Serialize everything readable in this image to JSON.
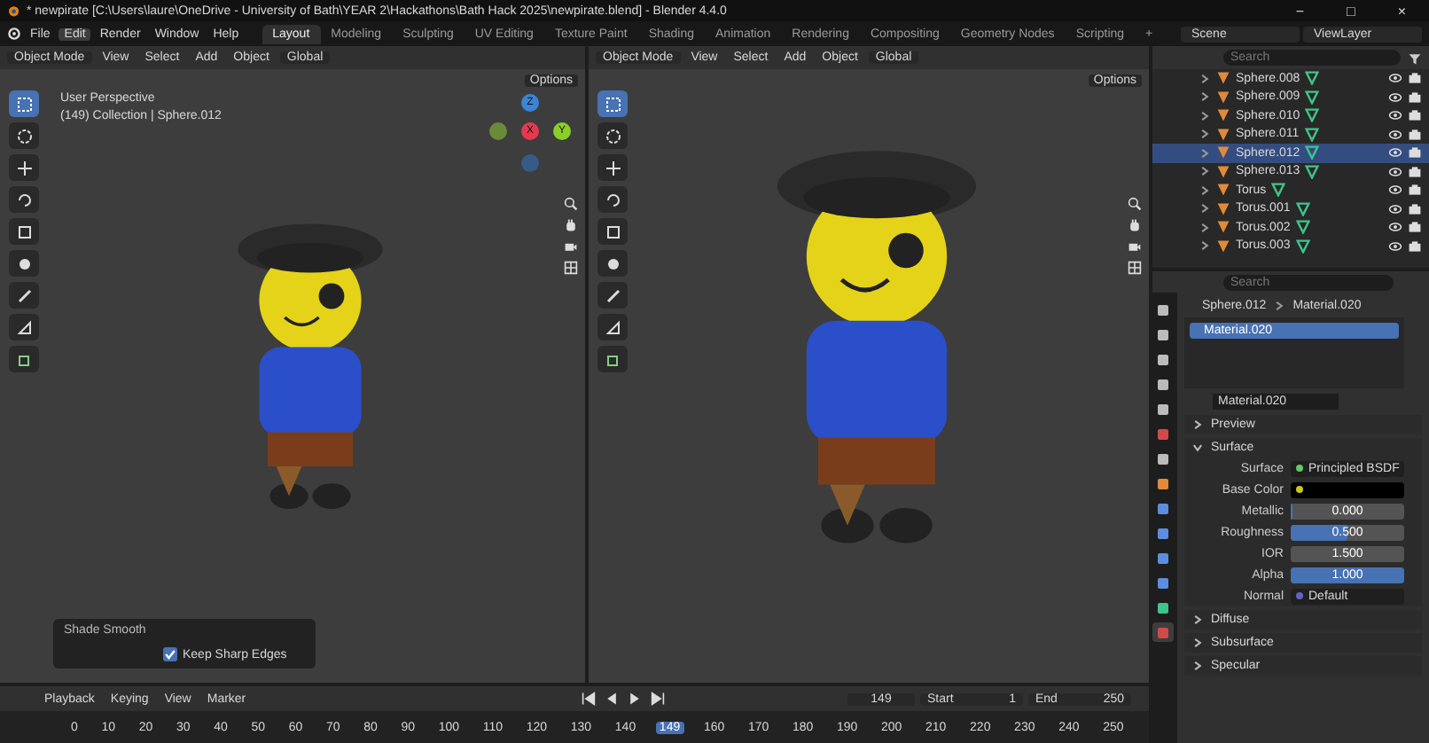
{
  "window": {
    "title": "* newpirate [C:\\Users\\laure\\OneDrive - University of Bath\\YEAR 2\\Hackathons\\Bath Hack 2025\\newpirate.blend] - Blender 4.4.0",
    "controls": [
      "−",
      "□",
      "×"
    ]
  },
  "menus": [
    {
      "label": "File",
      "selected": false
    },
    {
      "label": "Edit",
      "selected": true
    },
    {
      "label": "Render",
      "selected": false
    },
    {
      "label": "Window",
      "selected": false
    },
    {
      "label": "Help",
      "selected": false
    }
  ],
  "workspaces": [
    {
      "label": "Layout",
      "selected": true
    },
    {
      "label": "Modeling",
      "selected": false
    },
    {
      "label": "Sculpting",
      "selected": false
    },
    {
      "label": "UV Editing",
      "selected": false
    },
    {
      "label": "Texture Paint",
      "selected": false
    },
    {
      "label": "Shading",
      "selected": false
    },
    {
      "label": "Animation",
      "selected": false
    },
    {
      "label": "Rendering",
      "selected": false
    },
    {
      "label": "Compositing",
      "selected": false
    },
    {
      "label": "Geometry Nodes",
      "selected": false
    },
    {
      "label": "Scripting",
      "selected": false
    }
  ],
  "add_workspace": "+",
  "scene": "Scene",
  "view_layer": "ViewLayer",
  "viewports": [
    {
      "mode": "Object Mode",
      "menus": [
        "View",
        "Select",
        "Add",
        "Object"
      ],
      "orientation": "Global",
      "options": "Options",
      "overlay_lines": [
        "User Perspective",
        "(149) Collection | Sphere.012"
      ],
      "axes": [
        "Z",
        "X",
        "Y"
      ],
      "tools": [
        {
          "kind": "select",
          "selected": true
        },
        {
          "kind": "cursor",
          "selected": false
        },
        {
          "kind": "move",
          "selected": false
        },
        {
          "kind": "rotate",
          "selected": false
        },
        {
          "kind": "scale",
          "selected": false
        },
        {
          "kind": "transform",
          "selected": false
        },
        {
          "kind": "annotate",
          "selected": false
        },
        {
          "kind": "measure",
          "selected": false
        },
        {
          "kind": "cube",
          "selected": false
        }
      ],
      "operator_panel": {
        "title": "Shade Smooth",
        "option": {
          "label": "Keep Sharp Edges",
          "checked": true
        }
      }
    },
    {
      "mode": "Object Mode",
      "menus": [
        "View",
        "Select",
        "Add",
        "Object"
      ],
      "orientation": "Global",
      "options": "Options",
      "tools": [
        {
          "kind": "select",
          "selected": true
        },
        {
          "kind": "cursor",
          "selected": false
        },
        {
          "kind": "move",
          "selected": false
        },
        {
          "kind": "rotate",
          "selected": false
        },
        {
          "kind": "scale",
          "selected": false
        },
        {
          "kind": "transform",
          "selected": false
        },
        {
          "kind": "annotate",
          "selected": false
        },
        {
          "kind": "measure",
          "selected": false
        },
        {
          "kind": "cube",
          "selected": false
        }
      ]
    }
  ],
  "outliner": {
    "search": {
      "placeholder": "Search"
    },
    "rows": [
      {
        "name": "Sphere.008",
        "selected": false
      },
      {
        "name": "Sphere.009",
        "selected": false
      },
      {
        "name": "Sphere.010",
        "selected": false
      },
      {
        "name": "Sphere.011",
        "selected": false
      },
      {
        "name": "Sphere.012",
        "selected": true
      },
      {
        "name": "Sphere.013",
        "selected": false
      },
      {
        "name": "Torus",
        "selected": false
      },
      {
        "name": "Torus.001",
        "selected": false
      },
      {
        "name": "Torus.002",
        "selected": false
      },
      {
        "name": "Torus.003",
        "selected": false
      }
    ]
  },
  "properties": {
    "search": {
      "placeholder": "Search"
    },
    "tabs": [
      {
        "kind": "tool",
        "selected": false
      },
      {
        "kind": "render",
        "selected": false
      },
      {
        "kind": "output",
        "selected": false
      },
      {
        "kind": "view-layer",
        "selected": false
      },
      {
        "kind": "scene",
        "selected": false
      },
      {
        "kind": "world",
        "selected": false
      },
      {
        "kind": "collection",
        "selected": false
      },
      {
        "kind": "object",
        "selected": false
      },
      {
        "kind": "modifier",
        "selected": false
      },
      {
        "kind": "particles",
        "selected": false
      },
      {
        "kind": "physics",
        "selected": false
      },
      {
        "kind": "constraint",
        "selected": false
      },
      {
        "kind": "data",
        "selected": false
      },
      {
        "kind": "material",
        "selected": true
      }
    ],
    "breadcrumb": [
      "Sphere.012",
      "Material.020"
    ],
    "slots": [
      {
        "name": "Material.020",
        "selected": true
      }
    ],
    "material": "Material.020",
    "sections": [
      {
        "title": "Preview",
        "expanded": false
      },
      {
        "title": "Surface",
        "expanded": true,
        "fields": [
          {
            "label": "Surface",
            "kind": "shader",
            "value": "Principled BSDF"
          },
          {
            "label": "Base Color",
            "kind": "color"
          },
          {
            "label": "Metallic",
            "kind": "slider",
            "value": "0.000",
            "level": 0
          },
          {
            "label": "Roughness",
            "kind": "slider",
            "value": "0.500",
            "level": 0.5
          },
          {
            "label": "IOR",
            "kind": "number",
            "value": "1.500"
          },
          {
            "label": "Alpha",
            "kind": "slider",
            "value": "1.000",
            "level": 1
          },
          {
            "label": "Normal",
            "kind": "vector",
            "value": "Default"
          }
        ]
      },
      {
        "title": "Diffuse",
        "expanded": false
      },
      {
        "title": "Subsurface",
        "expanded": false
      },
      {
        "title": "Specular",
        "expanded": false
      }
    ]
  },
  "timeline": {
    "menus": [
      "Playback",
      "Keying",
      "View",
      "Marker"
    ],
    "frame": "149",
    "start_label": "Start",
    "start": "1",
    "end_label": "End",
    "end": "250",
    "ticks": [
      {
        "label": "0",
        "selected": false
      },
      {
        "label": "10",
        "selected": false
      },
      {
        "label": "20",
        "selected": false
      },
      {
        "label": "30",
        "selected": false
      },
      {
        "label": "40",
        "selected": false
      },
      {
        "label": "50",
        "selected": false
      },
      {
        "label": "60",
        "selected": false
      },
      {
        "label": "70",
        "selected": false
      },
      {
        "label": "80",
        "selected": false
      },
      {
        "label": "90",
        "selected": false
      },
      {
        "label": "100",
        "selected": false
      },
      {
        "label": "110",
        "selected": false
      },
      {
        "label": "120",
        "selected": false
      },
      {
        "label": "130",
        "selected": false
      },
      {
        "label": "140",
        "selected": false
      },
      {
        "label": "149",
        "selected": true
      },
      {
        "label": "160",
        "selected": false
      },
      {
        "label": "170",
        "selected": false
      },
      {
        "label": "180",
        "selected": false
      },
      {
        "label": "190",
        "selected": false
      },
      {
        "label": "200",
        "selected": false
      },
      {
        "label": "210",
        "selected": false
      },
      {
        "label": "220",
        "selected": false
      },
      {
        "label": "230",
        "selected": false
      },
      {
        "label": "240",
        "selected": false
      },
      {
        "label": "250",
        "selected": false
      }
    ]
  }
}
